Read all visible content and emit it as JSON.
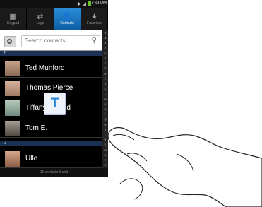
{
  "status_bar": {
    "time": "7:39 PM"
  },
  "tabs": [
    {
      "label": "Keypad",
      "icon": "keypad-icon",
      "active": false
    },
    {
      "label": "Logs",
      "icon": "logs-icon",
      "active": false
    },
    {
      "label": "Contacts",
      "icon": "contacts-icon",
      "active": true
    },
    {
      "label": "Favorites",
      "icon": "star-icon",
      "active": false
    }
  ],
  "search": {
    "placeholder": "Search contacts"
  },
  "index_letters": [
    "#",
    "A",
    "B",
    "C",
    "D",
    "E",
    "F",
    "G",
    "H",
    "I",
    "J",
    "K",
    "L",
    "M",
    "N",
    "O",
    "P",
    "Q",
    "R",
    "S",
    "T",
    "U",
    "V",
    "W",
    "X",
    "Y",
    "Z"
  ],
  "sections": {
    "first": "T",
    "second": "U"
  },
  "contacts": [
    {
      "name": "Ted Munford"
    },
    {
      "name": "Thomas Pierce"
    },
    {
      "name": "Tiffany Donald"
    },
    {
      "name": "Tom E."
    },
    {
      "name": "Ulle"
    }
  ],
  "popup_letter": "T",
  "footer_text": "11 contacts found",
  "colors": {
    "accent": "#2a86d6",
    "section_bg": "#1c2f55"
  }
}
